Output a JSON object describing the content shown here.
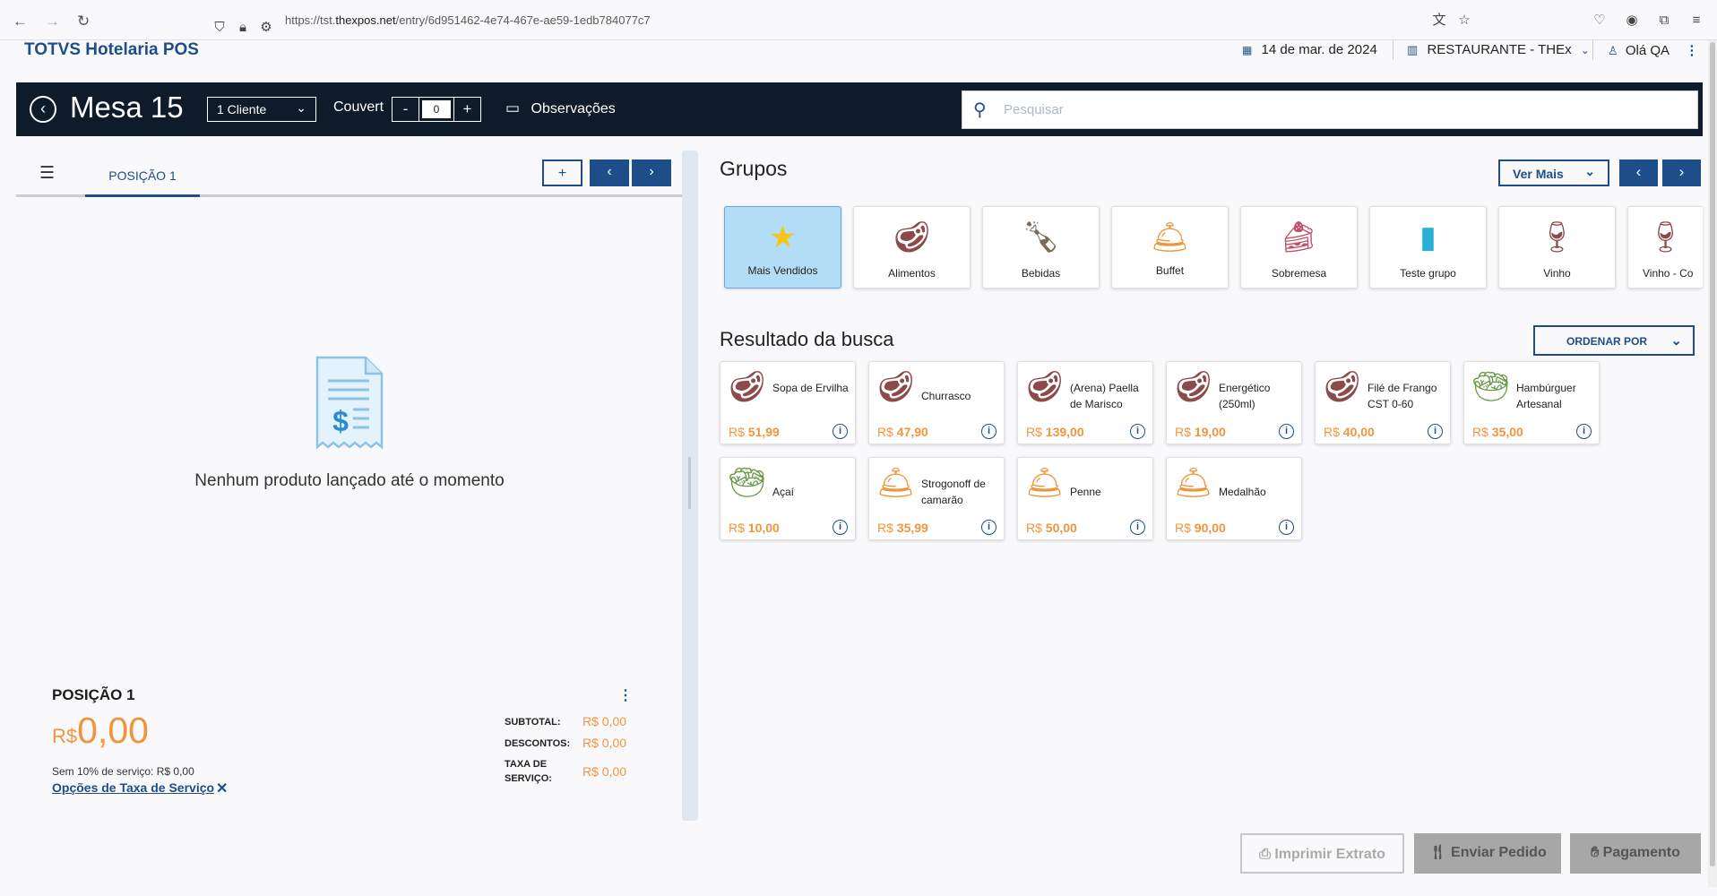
{
  "browser": {
    "url_prefix": "https://tst.",
    "url_domain": "thexpos.net",
    "url_path": "/entry/6d951462-4e74-467e-ae59-1edb784077c7"
  },
  "header": {
    "app_title": "TOTVS Hotelaria POS",
    "date": "14 de mar. de 2024",
    "restaurant": "RESTAURANTE - THEx",
    "user_greeting": "Olá QA"
  },
  "order_bar": {
    "table_title": "Mesa 15",
    "client_select": "1 Cliente",
    "couvert_label": "Couvert",
    "couvert_minus": "-",
    "couvert_value": "0",
    "couvert_plus": "+",
    "observations": "Observações",
    "search_placeholder": "Pesquisar"
  },
  "left": {
    "tab_label": "POSIÇÃO 1",
    "add_btn": "+",
    "prev_btn": "‹",
    "next_btn": "›",
    "empty_message": "Nenhum produto lançado até o momento",
    "summary": {
      "position_title": "POSIÇÃO 1",
      "currency": "R$",
      "total": "0,00",
      "service_note": "Sem 10% de serviço: R$ 0,00",
      "service_options_link": "Opções de Taxa de Serviço",
      "subtotal_label": "SUBTOTAL:",
      "subtotal_value": "R$ 0,00",
      "discounts_label": "DESCONTOS:",
      "discounts_value": "R$ 0,00",
      "service_fee_label_1": "TAXA DE",
      "service_fee_label_2": "SERVIÇO:",
      "service_fee_value": "R$ 0,00"
    }
  },
  "groups": {
    "title": "Grupos",
    "see_more": "Ver Mais",
    "items": [
      {
        "name": "Mais Vendidos",
        "icon": "star-icon"
      },
      {
        "name": "Alimentos",
        "icon": "steak-icon"
      },
      {
        "name": "Bebidas",
        "icon": "bottle-icon"
      },
      {
        "name": "Buffet",
        "icon": "cloche-icon"
      },
      {
        "name": "Sobremesa",
        "icon": "cake-icon"
      },
      {
        "name": "Teste grupo",
        "icon": "can-icon"
      },
      {
        "name": "Vinho",
        "icon": "wine-icon"
      },
      {
        "name": "Vinho - Co",
        "icon": "wine-icon"
      }
    ]
  },
  "results": {
    "title": "Resultado da busca",
    "order_by": "ORDENAR POR",
    "items": [
      {
        "name": "Sopa de Ervilha",
        "price": "51,99",
        "icon": "steak-icon"
      },
      {
        "name": "Churrasco",
        "price": "47,90",
        "icon": "steak-icon"
      },
      {
        "name": "(Arena) Paella de Marisco",
        "price": "139,00",
        "icon": "steak-icon"
      },
      {
        "name": "Energético (250ml)",
        "price": "19,00",
        "icon": "steak-icon"
      },
      {
        "name": "Filé de Frango CST 0-60",
        "price": "40,00",
        "icon": "steak-icon"
      },
      {
        "name": "Hambúrguer Artesanal",
        "price": "35,00",
        "icon": "salad-icon"
      },
      {
        "name": "Açaí",
        "price": "10,00",
        "icon": "salad-icon"
      },
      {
        "name": "Strogonoff de camarão",
        "price": "35,99",
        "icon": "cloche-icon"
      },
      {
        "name": "Penne",
        "price": "50,00",
        "icon": "cloche-icon"
      },
      {
        "name": "Medalhão",
        "price": "90,00",
        "icon": "cloche-icon"
      }
    ],
    "currency": "R$"
  },
  "footer": {
    "print": "Imprimir Extrato",
    "send": "Enviar Pedido",
    "pay": "Pagamento"
  },
  "colors": {
    "brand": "#1d4e89",
    "dark_bar": "#0d1b2a",
    "price": "#f0953d",
    "selected_group": "#b3dcf6"
  }
}
